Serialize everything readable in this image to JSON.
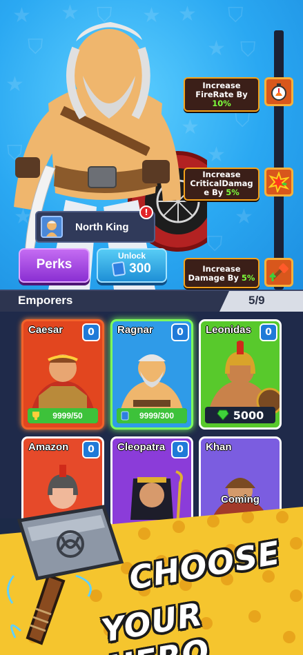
{
  "perks_track": {
    "rewards": [
      {
        "line1": "Increase",
        "line2": "FireRate By",
        "value": "10%",
        "icon": "stopwatch-icon"
      },
      {
        "line1": "Increase",
        "line2": "CriticalDamag",
        "line3": "e By",
        "value": "5%",
        "icon": "critical-burst-icon"
      },
      {
        "line1": "Increase",
        "line2": "Damage By",
        "value": "5%",
        "icon": "hammer-upgrade-icon"
      }
    ]
  },
  "hero": {
    "name": "North King",
    "alert": "!"
  },
  "buttons": {
    "perks": "Perks",
    "unlock_label": "Unlock",
    "unlock_cost": "300"
  },
  "roster": {
    "title": "Emporers",
    "count": "5/9",
    "heroes": [
      {
        "name": "Caesar",
        "level": "0",
        "progress_text": "9999/50",
        "progress": 1.0,
        "frame_color": "#f2622a",
        "bg": "#e2461f"
      },
      {
        "name": "Ragnar",
        "level": "0",
        "progress_text": "9999/300",
        "progress": 1.0,
        "frame_color": "#7dff5c",
        "bg": "#2f9be8"
      },
      {
        "name": "Leonidas",
        "level": "0",
        "price": "5000",
        "frame_color": "#ffffff",
        "bg": "#58c92c"
      },
      {
        "name": "Amazon",
        "level": "0",
        "frame_color": "#ffffff",
        "bg": "#e64a2a"
      },
      {
        "name": "Cleopatra",
        "level": "0",
        "frame_color": "#ffffff",
        "bg": "#8b3cd9"
      },
      {
        "name": "Khan",
        "status": "Coming",
        "frame_color": "#ffffff",
        "bg": "#7b5de0"
      }
    ]
  },
  "promo": {
    "line1": "CHOOSE",
    "line2": "YOUR HERO"
  }
}
